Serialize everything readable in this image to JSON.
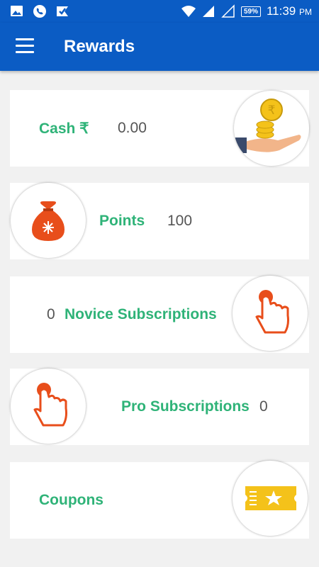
{
  "status_bar": {
    "battery": "59%",
    "time": "11:39",
    "ampm": "PM"
  },
  "app_bar": {
    "title": "Rewards"
  },
  "cards": {
    "cash": {
      "label": "Cash ₹",
      "value": "0.00",
      "icon": "money-hand-icon"
    },
    "points": {
      "label": "Points",
      "value": "100",
      "icon": "money-bag-icon"
    },
    "novice": {
      "label": "Novice Subscriptions",
      "value": "0",
      "icon": "tap-hand-icon"
    },
    "pro": {
      "label": "Pro Subscriptions",
      "value": "0",
      "icon": "tap-hand-icon"
    },
    "coupons": {
      "label": "Coupons",
      "icon": "ticket-icon"
    }
  },
  "colors": {
    "brand": "#0b5cc4",
    "label_green": "#2fb378",
    "accent_orange": "#e84e1b",
    "coin_gold": "#f4c21a"
  }
}
